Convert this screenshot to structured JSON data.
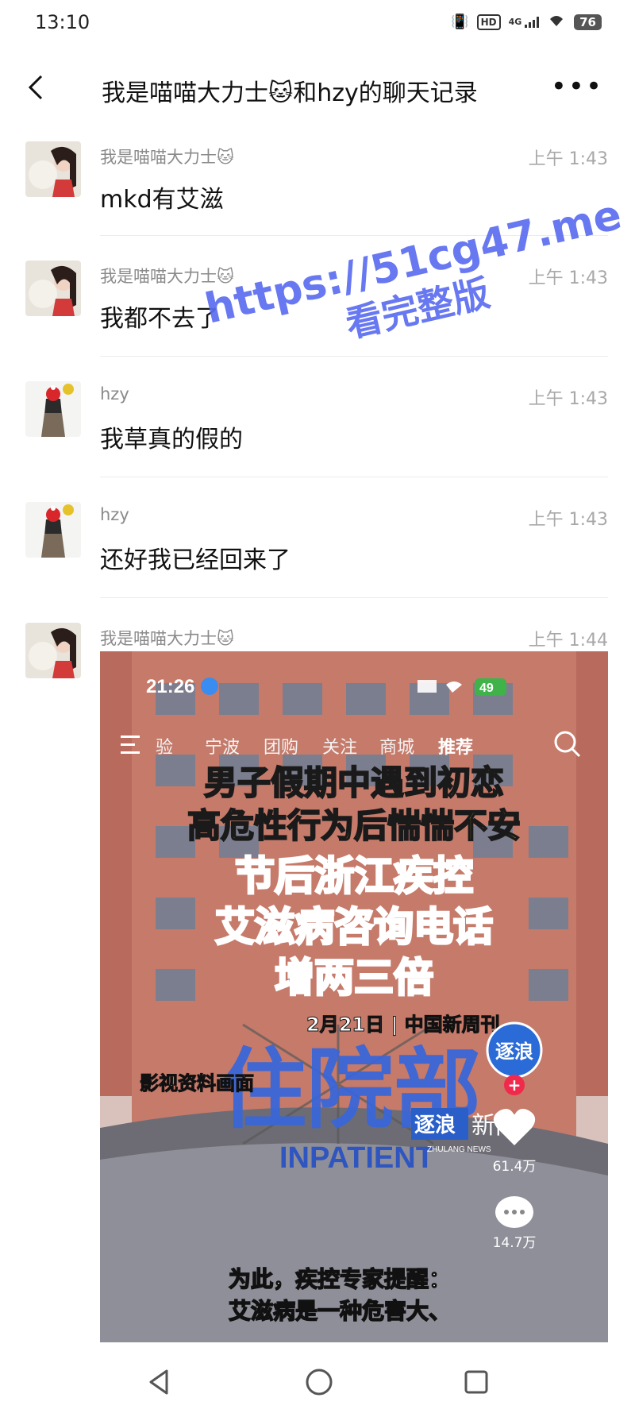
{
  "status_bar": {
    "time": "13:10",
    "network": "4G",
    "hd": "HD",
    "battery": "76"
  },
  "header": {
    "title": "我是喵喵大力士🐱和hzy的聊天记录"
  },
  "messages": [
    {
      "sender": "我是喵喵大力士🐱",
      "time": "上午 1:43",
      "text": "mkd有艾滋"
    },
    {
      "sender": "我是喵喵大力士🐱",
      "time": "上午 1:43",
      "text": "我都不去了"
    },
    {
      "sender": "hzy",
      "time": "上午 1:43",
      "text": "我草真的假的"
    },
    {
      "sender": "hzy",
      "time": "上午 1:43",
      "text": "还好我已经回来了"
    },
    {
      "sender": "我是喵喵大力士🐱",
      "time": "上午 1:44",
      "text": ""
    }
  ],
  "video": {
    "inner_time": "21:26",
    "inner_battery": "49",
    "tabs": [
      "验",
      "宁波",
      "团购",
      "关注",
      "商城",
      "推荐"
    ],
    "headline_yellow_1": "男子假期中遇到初恋",
    "headline_yellow_2": "高危性行为后惴惴不安",
    "headline_red_1": "节后浙江疾控",
    "headline_red_2": "艾滋病咨询电话",
    "headline_red_3": "增两三倍",
    "date_source": "2月21日 | 中国新周刊",
    "footage_note": "影视资料画面",
    "building_sign": "住院部",
    "building_sign_en": "INPATIENT",
    "brand_badge": "逐浪",
    "brand_logo_a": "逐浪",
    "brand_logo_b": "新闻",
    "brand_logo_sub": "ZHULANG NEWS",
    "likes": "61.4万",
    "comments": "14.7万",
    "subtitle_1": "为此，疾控专家提醒：",
    "subtitle_2": "艾滋病是一种危害大、"
  },
  "watermark": {
    "line1": "https://51cg47.me",
    "line2": "看完整版"
  },
  "colors": {
    "accent_watermark": "#5b6df0",
    "headline_yellow": "#ffe11a",
    "headline_red": "#e8202a"
  }
}
